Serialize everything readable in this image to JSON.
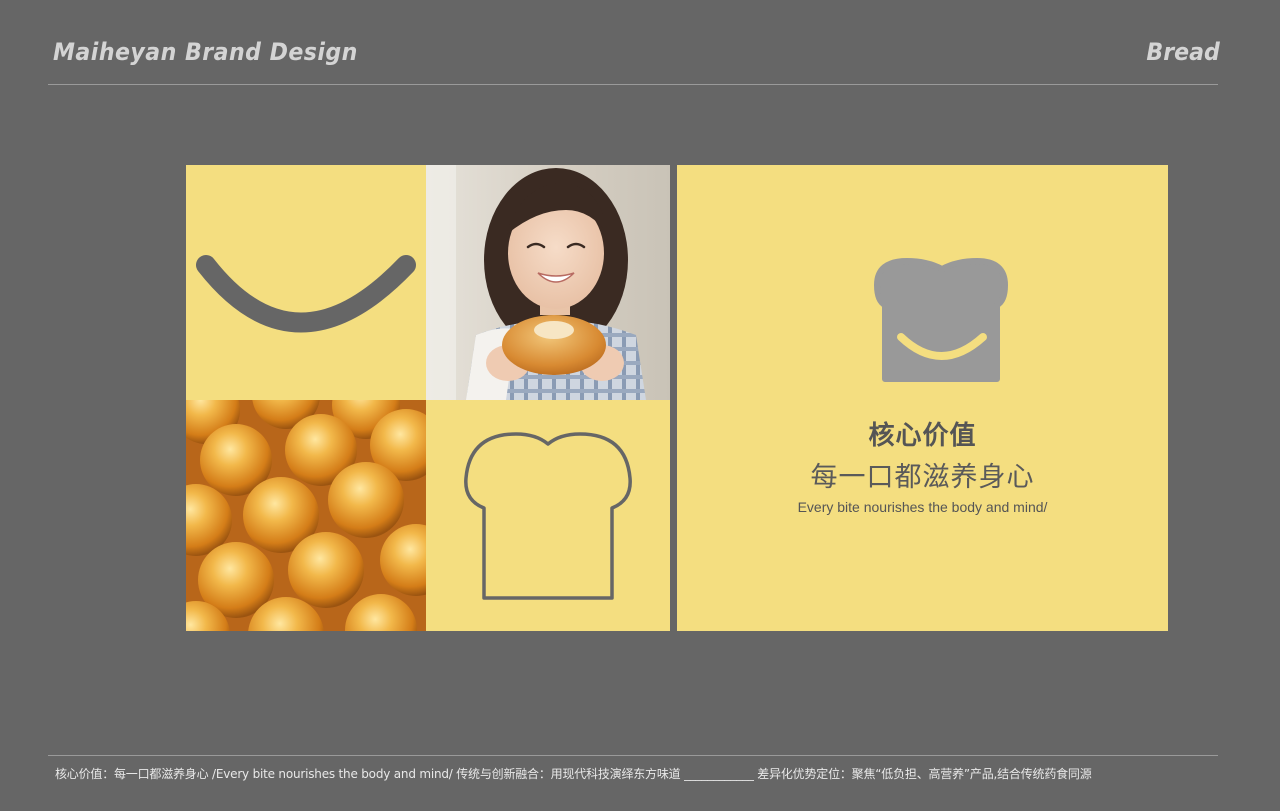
{
  "header": {
    "brand_title": "Maiheyan Brand Design",
    "category": "Bread"
  },
  "panel": {
    "value_title": "核心价值",
    "value_slogan": "每一口都滋养身心",
    "value_english": "Every bite nourishes the body and mind/"
  },
  "footer": {
    "note": "核心价值：每一口都滋养身心 /Every bite nourishes the body and mind/ 传统与创新融合：用现代科技演绎东方味道 ____________ 差异化优势定位：聚焦“低负担、高营养”产品,结合传统药食同源"
  },
  "colors": {
    "background": "#666666",
    "panel_yellow": "#f4de80",
    "logo_gray": "#999999",
    "line_gray": "#666666",
    "text_light": "#d4d4d4"
  },
  "icons": {
    "smile": "smile-curve-icon",
    "outline": "bread-outline-icon",
    "logo": "bread-smile-logo-icon"
  }
}
